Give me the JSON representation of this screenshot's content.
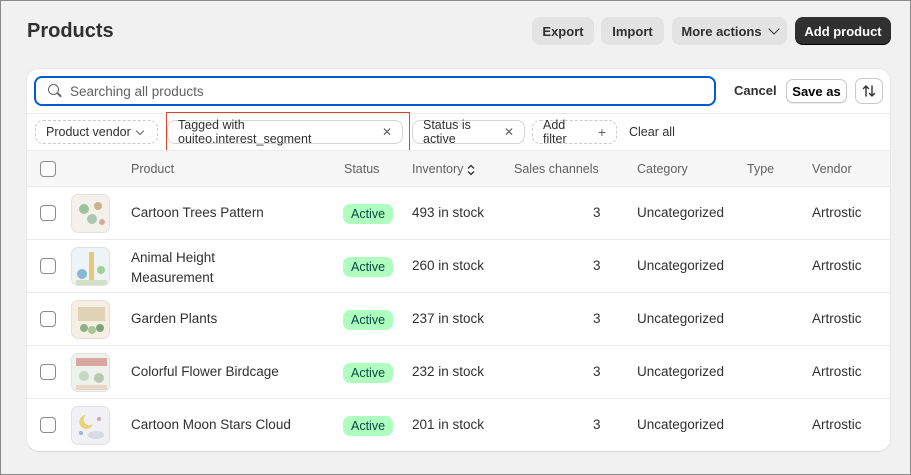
{
  "header": {
    "title": "Products",
    "export_label": "Export",
    "import_label": "Import",
    "more_actions_label": "More actions",
    "add_product_label": "Add product"
  },
  "search": {
    "placeholder": "Searching all products",
    "cancel_label": "Cancel",
    "save_as_label": "Save as"
  },
  "filters": {
    "vendor_label": "Product vendor",
    "tagged_label": "Tagged with ouiteo.interest_segment",
    "status_label": "Status is active",
    "add_filter_label": "Add filter",
    "clear_all_label": "Clear all"
  },
  "table": {
    "columns": [
      "Product",
      "Status",
      "Inventory",
      "Sales channels",
      "Category",
      "Type",
      "Vendor"
    ],
    "rows": [
      {
        "product": "Cartoon Trees Pattern",
        "status": "Active",
        "inventory": "493 in stock",
        "channels": "3",
        "category": "Uncategorized",
        "type": "",
        "vendor": "Artrostic"
      },
      {
        "product": "Animal Height Measurement",
        "status": "Active",
        "inventory": "260 in stock",
        "channels": "3",
        "category": "Uncategorized",
        "type": "",
        "vendor": "Artrostic"
      },
      {
        "product": "Garden Plants",
        "status": "Active",
        "inventory": "237 in stock",
        "channels": "3",
        "category": "Uncategorized",
        "type": "",
        "vendor": "Artrostic"
      },
      {
        "product": "Colorful Flower Birdcage",
        "status": "Active",
        "inventory": "232 in stock",
        "channels": "3",
        "category": "Uncategorized",
        "type": "",
        "vendor": "Artrostic"
      },
      {
        "product": "Cartoon Moon Stars Cloud",
        "status": "Active",
        "inventory": "201 in stock",
        "channels": "3",
        "category": "Uncategorized",
        "type": "",
        "vendor": "Artrostic"
      }
    ]
  },
  "colors": {
    "accent": "#005bd3",
    "primary_button": "#303030",
    "active_badge_bg": "#affebf",
    "active_badge_text": "#014b40",
    "highlight_box": "#d9472b"
  },
  "icons": {
    "search": "search-icon",
    "sort": "sort-icon",
    "chevron": "chevron-down-icon",
    "remove": "close-icon",
    "add": "plus-icon"
  }
}
